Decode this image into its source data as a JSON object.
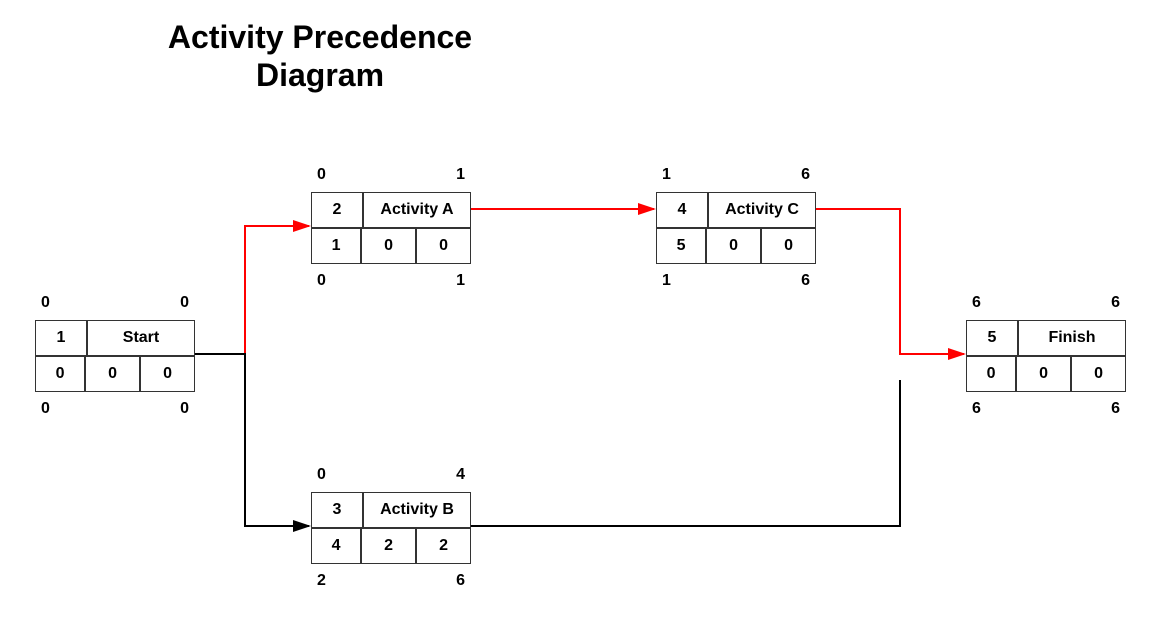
{
  "title": "Activity Precedence Diagram",
  "chart_data": {
    "type": "table",
    "title": "Activity Precedence Diagram",
    "legend": {
      "critical_path_color": "#ff0000",
      "non_critical_color": "#000000"
    },
    "nodes": [
      {
        "key": "start",
        "id": 1,
        "name": "Start",
        "duration": 0,
        "es": 0,
        "ef": 0,
        "ls": 0,
        "lf": 0,
        "ff": 0,
        "tf": 0
      },
      {
        "key": "a",
        "id": 2,
        "name": "Activity A",
        "duration": 1,
        "es": 0,
        "ef": 1,
        "ls": 0,
        "lf": 1,
        "ff": 0,
        "tf": 0
      },
      {
        "key": "b",
        "id": 3,
        "name": "Activity B",
        "duration": 4,
        "es": 0,
        "ef": 4,
        "ls": 2,
        "lf": 6,
        "ff": 2,
        "tf": 2
      },
      {
        "key": "c",
        "id": 4,
        "name": "Activity C",
        "duration": 5,
        "es": 1,
        "ef": 6,
        "ls": 1,
        "lf": 6,
        "ff": 0,
        "tf": 0
      },
      {
        "key": "finish",
        "id": 5,
        "name": "Finish",
        "duration": 0,
        "es": 6,
        "ef": 6,
        "ls": 6,
        "lf": 6,
        "ff": 0,
        "tf": 0
      }
    ],
    "edges": [
      {
        "from": "start",
        "to": "a",
        "critical": true
      },
      {
        "from": "start",
        "to": "b",
        "critical": false
      },
      {
        "from": "a",
        "to": "c",
        "critical": true
      },
      {
        "from": "c",
        "to": "finish",
        "critical": true
      },
      {
        "from": "b",
        "to": "finish",
        "critical": false
      }
    ]
  }
}
